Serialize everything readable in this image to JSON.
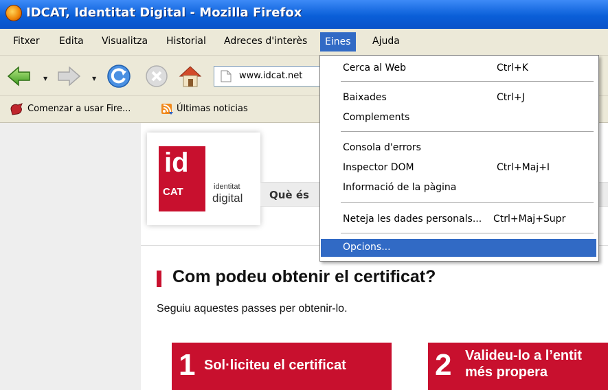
{
  "window": {
    "title": "IDCAT, Identitat Digital - Mozilla Firefox"
  },
  "menubar": {
    "items": [
      {
        "label": "Fitxer"
      },
      {
        "label": "Edita"
      },
      {
        "label": "Visualitza"
      },
      {
        "label": "Historial"
      },
      {
        "label": "Adreces d'interès"
      },
      {
        "label": "Eines"
      },
      {
        "label": "Ajuda"
      }
    ]
  },
  "toolbar": {
    "url": "www.idcat.net"
  },
  "bookmarks": {
    "items": [
      {
        "label": "Comenzar a usar Fire..."
      },
      {
        "label": "Últimas noticias"
      }
    ]
  },
  "tools_menu": {
    "items": [
      {
        "label": "Cerca al Web",
        "accel": "Ctrl+K"
      },
      {
        "label": "Baixades",
        "accel": "Ctrl+J"
      },
      {
        "label": "Complements",
        "accel": ""
      },
      {
        "label": "Consola d'errors",
        "accel": ""
      },
      {
        "label": "Inspector DOM",
        "accel": "Ctrl+Maj+I"
      },
      {
        "label": "Informació de la pàgina",
        "accel": ""
      },
      {
        "label": "Neteja les dades personals...",
        "accel": "Ctrl+Maj+Supr"
      },
      {
        "label": "Opcions..."
      }
    ]
  },
  "page": {
    "logo": {
      "id": "id",
      "cat": "CAT",
      "line1": "identitat",
      "line2": "digital"
    },
    "nav_tab": "Què és",
    "heading": "Com podeu obtenir el certificat?",
    "subtext": "Seguiu aquestes passes per obtenir-lo.",
    "steps": [
      {
        "number": "1",
        "label": "Sol·liciteu el certificat"
      },
      {
        "number": "2",
        "label_line1": "Valideu-lo a l’entit",
        "label_line2": "més propera"
      }
    ]
  },
  "colors": {
    "brand_red": "#c8102e",
    "selection_blue": "#316ac5",
    "titlebar_blue": "#0a5fd8"
  }
}
